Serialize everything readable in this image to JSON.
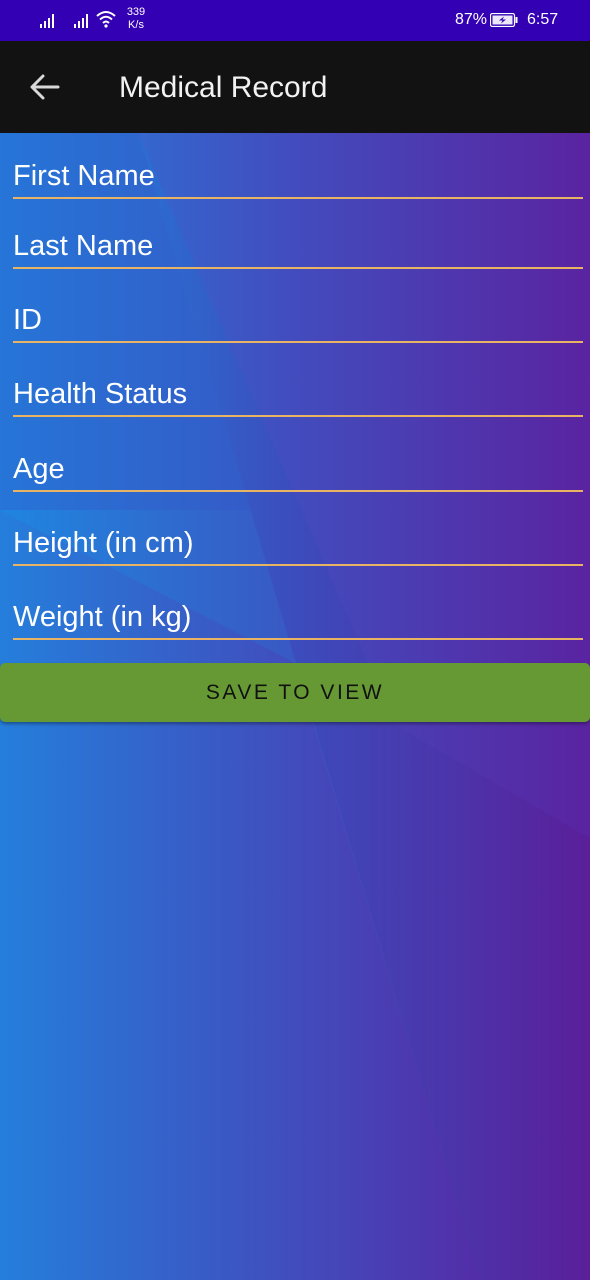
{
  "status_bar": {
    "net_speed_value": "339",
    "net_speed_unit": "K/s",
    "battery_percent": "87%",
    "time": "6:57",
    "icons": [
      "signal-icon",
      "signal-icon",
      "wifi-icon",
      "battery-icon"
    ]
  },
  "app_bar": {
    "title": "Medical Record",
    "back_icon": "arrow-back-icon"
  },
  "form": {
    "fields": [
      {
        "placeholder": "First Name",
        "value": ""
      },
      {
        "placeholder": "Last Name",
        "value": ""
      },
      {
        "placeholder": "ID",
        "value": ""
      },
      {
        "placeholder": "Health Status",
        "value": ""
      },
      {
        "placeholder": "Age",
        "value": ""
      },
      {
        "placeholder": "Height (in cm)",
        "value": ""
      },
      {
        "placeholder": "Weight (in kg)",
        "value": ""
      }
    ],
    "save_label": "SAVE TO VIEW"
  },
  "colors": {
    "status_bar": "#3300b3",
    "app_bar": "#121212",
    "field_underline": "#e8b363",
    "save_button": "#669933",
    "gradient_left": "#1b8fe8",
    "gradient_right": "#5a1f9a"
  }
}
